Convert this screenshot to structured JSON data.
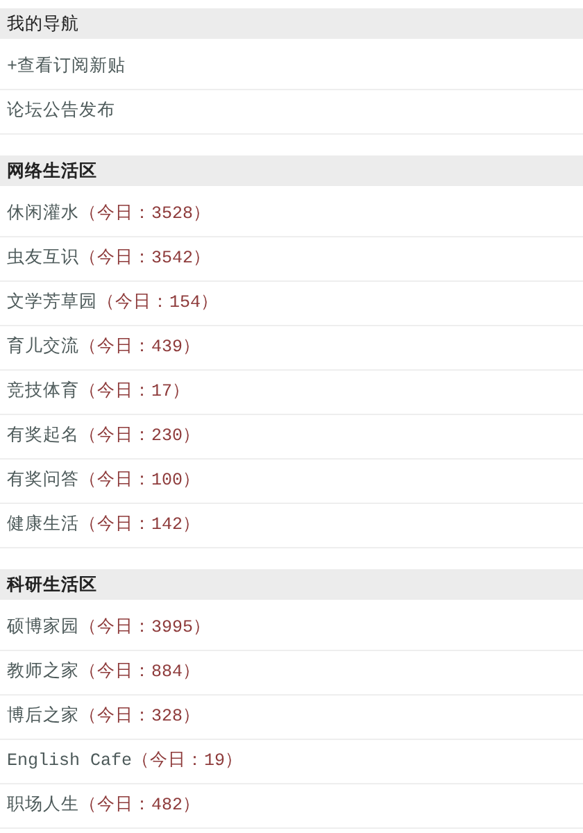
{
  "sections": [
    {
      "title": "我的导航",
      "items": [
        {
          "name": "+查看订阅新贴"
        },
        {
          "name": "论坛公告发布"
        }
      ]
    },
    {
      "title": "网络生活区",
      "items": [
        {
          "name": "休闲灌水",
          "count": "（今日：3528）"
        },
        {
          "name": "虫友互识",
          "count": "（今日：3542）"
        },
        {
          "name": "文学芳草园",
          "count": "（今日：154）"
        },
        {
          "name": "育儿交流",
          "count": "（今日：439）"
        },
        {
          "name": "竞技体育",
          "count": "（今日：17）"
        },
        {
          "name": "有奖起名",
          "count": "（今日：230）"
        },
        {
          "name": "有奖问答",
          "count": "（今日：100）"
        },
        {
          "name": "健康生活",
          "count": "（今日：142）"
        }
      ]
    },
    {
      "title": "科研生活区",
      "items": [
        {
          "name": "硕博家园",
          "count": "（今日：3995）"
        },
        {
          "name": "教师之家",
          "count": "（今日：884）"
        },
        {
          "name": "博后之家",
          "count": "（今日：328）"
        },
        {
          "name": "English Cafe",
          "count": "（今日：19）"
        },
        {
          "name": "职场人生",
          "count": "（今日：482）"
        }
      ]
    }
  ]
}
